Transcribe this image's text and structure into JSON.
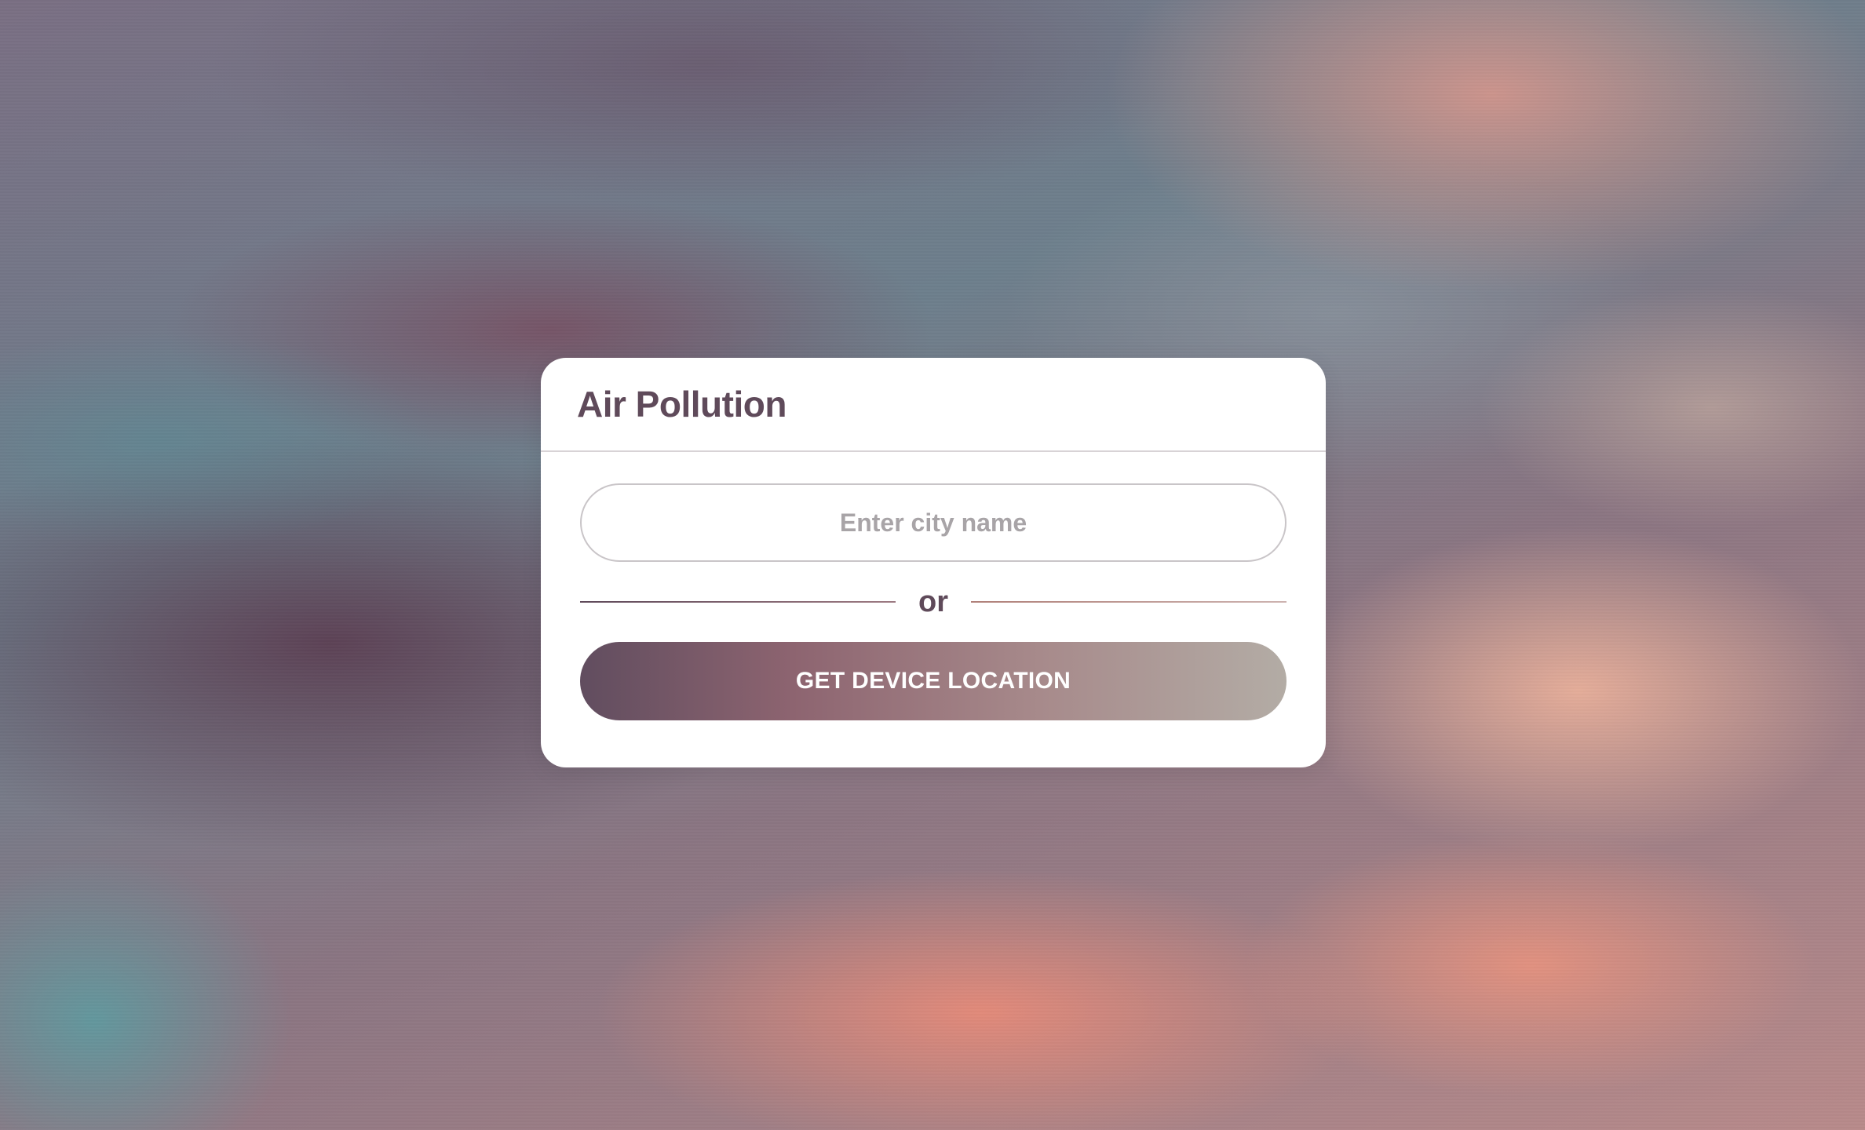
{
  "card": {
    "title": "Air Pollution",
    "search": {
      "placeholder": "Enter city name",
      "value": ""
    },
    "divider_text": "or",
    "location_button_label": "GET DEVICE LOCATION"
  },
  "colors": {
    "title_text": "#5f4a5a",
    "placeholder_text": "#a8a4a7",
    "button_gradient_start": "#614d5f",
    "button_gradient_end": "#b3aca5",
    "card_background": "#ffffff"
  }
}
